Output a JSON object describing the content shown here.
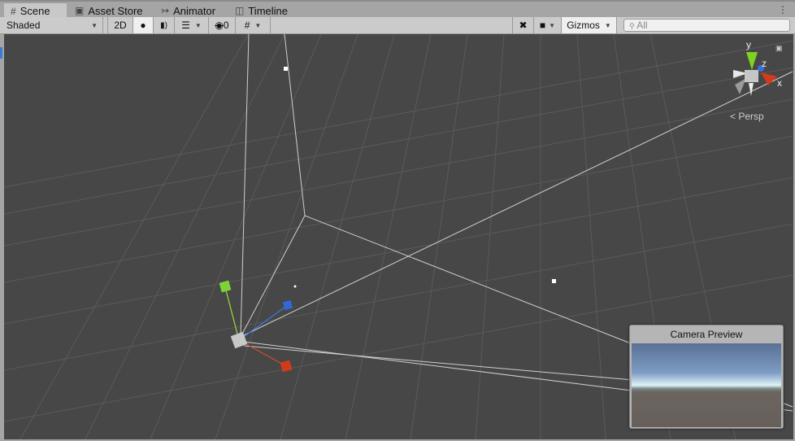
{
  "tabs": [
    {
      "label": "Scene",
      "icon": "grid-icon",
      "active": true
    },
    {
      "label": "Asset Store",
      "icon": "bag-icon"
    },
    {
      "label": "Animator",
      "icon": "animator-icon"
    },
    {
      "label": "Timeline",
      "icon": "film-icon"
    }
  ],
  "toolbar": {
    "draw_mode": "Shaded",
    "twod": "2D",
    "hidden_count": "0",
    "gizmos": "Gizmos",
    "search_placeholder": "All"
  },
  "scene": {
    "projection": "Persp",
    "axes": {
      "x": "x",
      "y": "y",
      "z": "z"
    },
    "camera_preview_title": "Camera Preview"
  }
}
